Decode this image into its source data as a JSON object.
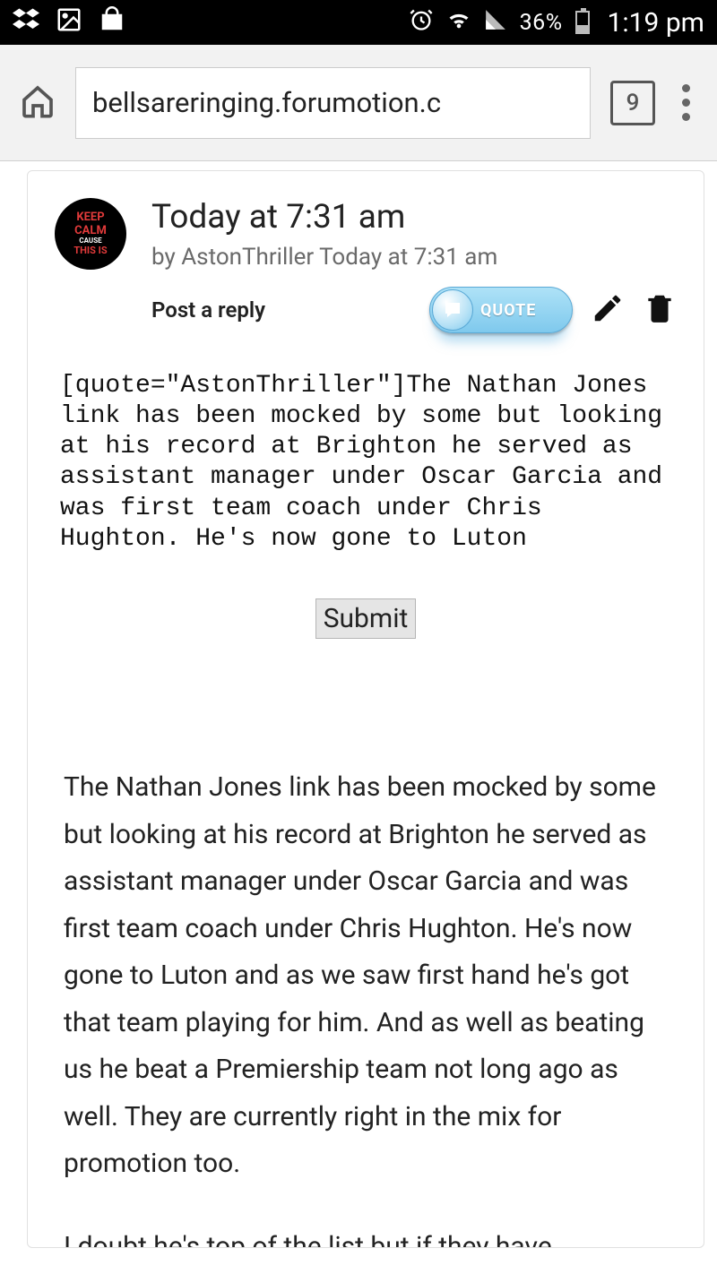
{
  "status": {
    "battery_pct": "36%",
    "time": "1:19 pm"
  },
  "browser": {
    "url": "bellsareringing.forumotion.c",
    "tabs_count": "9"
  },
  "post": {
    "avatar": {
      "l1": "KEEP",
      "l2": "CALM",
      "l3": "CAUSE",
      "l4": "THIS IS"
    },
    "title": "Today at 7:31 am",
    "byline": "by AstonThriller Today at 7:31 am",
    "reply_label": "Post a reply",
    "quote_label": "QUOTE",
    "textarea_value": "[quote=\"AstonThriller\"]The Nathan Jones link has been mocked by some but looking at his record at Brighton he served as assistant manager under Oscar Garcia and was first team coach under Chris Hughton. He's now gone to Luton",
    "submit_label": "Submit",
    "body_p1": "The Nathan Jones link has been mocked by some but looking at his record at Brighton he served as assistant manager under Oscar Garcia and was first team coach under Chris Hughton. He's now gone to Luton and as we saw first hand he's got that team playing for him. And as well as beating us he beat a Premiership team not long ago as well. They are currently right in the mix for promotion too.",
    "body_p2": "I doubt he's top of the list but if they have"
  }
}
